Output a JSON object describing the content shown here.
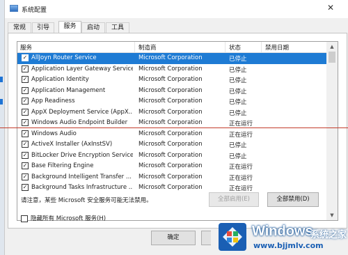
{
  "window": {
    "title": "系统配置",
    "close_glyph": "✕"
  },
  "tabs": [
    {
      "label": "常规",
      "active": false
    },
    {
      "label": "引导",
      "active": false
    },
    {
      "label": "服务",
      "active": true
    },
    {
      "label": "启动",
      "active": false
    },
    {
      "label": "工具",
      "active": false
    }
  ],
  "table": {
    "columns": {
      "service": "服务",
      "manufacturer": "制造商",
      "status": "状态",
      "disabled_date": "禁用日期"
    },
    "rows": [
      {
        "name": "AllJoyn Router Service",
        "manufacturer": "Microsoft Corporation",
        "status": "已停止",
        "checked": true,
        "selected": true
      },
      {
        "name": "Application Layer Gateway Service",
        "manufacturer": "Microsoft Corporation",
        "status": "已停止",
        "checked": true,
        "selected": false
      },
      {
        "name": "Application Identity",
        "manufacturer": "Microsoft Corporation",
        "status": "已停止",
        "checked": true,
        "selected": false
      },
      {
        "name": "Application Management",
        "manufacturer": "Microsoft Corporation",
        "status": "已停止",
        "checked": true,
        "selected": false
      },
      {
        "name": "App Readiness",
        "manufacturer": "Microsoft Corporation",
        "status": "已停止",
        "checked": true,
        "selected": false
      },
      {
        "name": "AppX Deployment Service (AppX...",
        "manufacturer": "Microsoft Corporation",
        "status": "已停止",
        "checked": true,
        "selected": false
      },
      {
        "name": "Windows Audio Endpoint Builder",
        "manufacturer": "Microsoft Corporation",
        "status": "正在运行",
        "checked": true,
        "selected": false
      },
      {
        "name": "Windows Audio",
        "manufacturer": "Microsoft Corporation",
        "status": "正在运行",
        "checked": true,
        "selected": false
      },
      {
        "name": "ActiveX Installer (AxInstSV)",
        "manufacturer": "Microsoft Corporation",
        "status": "已停止",
        "checked": true,
        "selected": false
      },
      {
        "name": "BitLocker Drive Encryption Service",
        "manufacturer": "Microsoft Corporation",
        "status": "已停止",
        "checked": true,
        "selected": false
      },
      {
        "name": "Base Filtering Engine",
        "manufacturer": "Microsoft Corporation",
        "status": "正在运行",
        "checked": true,
        "selected": false
      },
      {
        "name": "Background Intelligent Transfer ...",
        "manufacturer": "Microsoft Corporation",
        "status": "正在运行",
        "checked": true,
        "selected": false
      },
      {
        "name": "Background Tasks Infrastructure ...",
        "manufacturer": "Microsoft Corporation",
        "status": "正在运行",
        "checked": true,
        "selected": false
      }
    ]
  },
  "note": "请注意，某些 Microsoft 安全服务可能无法禁用。",
  "buttons": {
    "enable_all": "全部启用(E)",
    "disable_all": "全部禁用(D)",
    "ok": "确定"
  },
  "hide_ms_label": "隐藏所有 Microsoft 服务(H)",
  "watermark": {
    "brand": "Windows",
    "sub": "系统之家",
    "url": "www.bjjmlv.com"
  },
  "colors": {
    "selection": "#1e7bd4",
    "accent_blue": "#1a5fb4"
  }
}
